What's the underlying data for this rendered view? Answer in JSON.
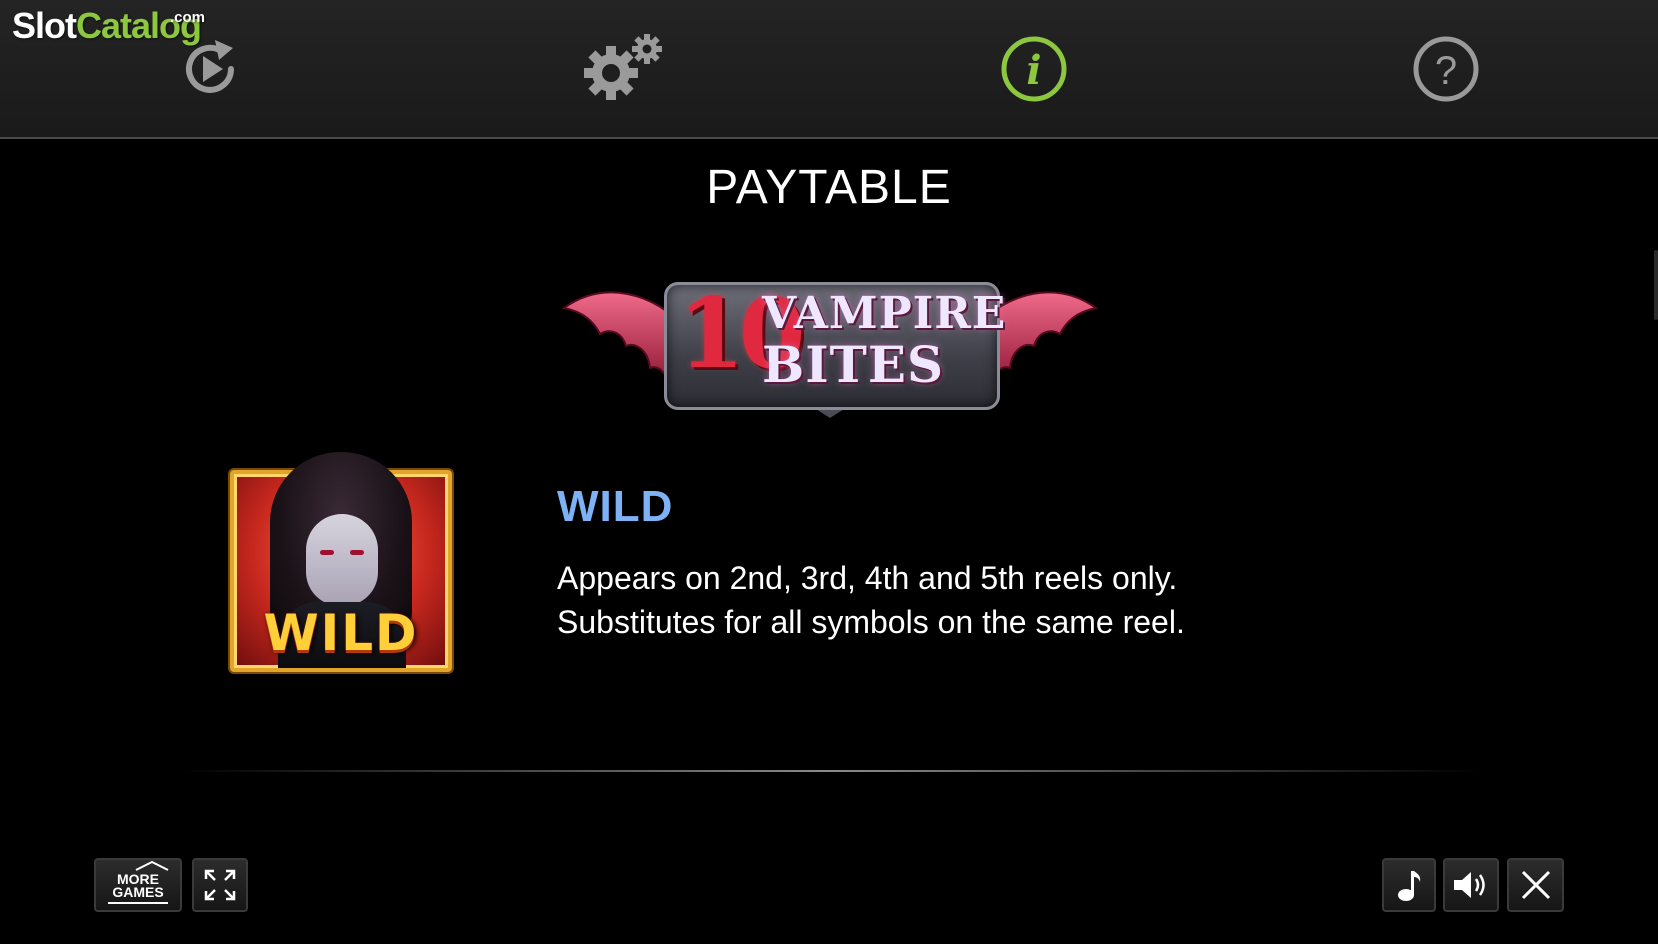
{
  "watermark": {
    "part1": "Slot",
    "part2": "Catalog",
    "suffix": ".com"
  },
  "top_nav": {
    "items": [
      {
        "id": "autoplay",
        "icon": "autoplay-replay-icon",
        "active": false
      },
      {
        "id": "settings",
        "icon": "gears-icon",
        "active": false
      },
      {
        "id": "info",
        "icon": "info-icon",
        "active": true
      },
      {
        "id": "help",
        "icon": "question-icon",
        "active": false
      }
    ],
    "active_color": "#8dc63f",
    "inactive_color": "#9a9a9a"
  },
  "page": {
    "title": "PAYTABLE"
  },
  "logo": {
    "number": "10",
    "line1": "VAMPIRE",
    "line2": "BITES"
  },
  "symbol": {
    "label": "WILD",
    "heading": "WILD",
    "description_line1": "Appears on 2nd, 3rd, 4th and 5th reels only.",
    "description_line2": "Substitutes for all symbols on the same reel."
  },
  "bottom_bar": {
    "more_games_line1": "MORE",
    "more_games_line2": "GAMES",
    "fullscreen_icon": "fullscreen-icon",
    "music_icon": "music-note-icon",
    "sound_icon": "speaker-icon",
    "close_icon": "close-icon"
  },
  "colors": {
    "heading_blue": "#7db2f5",
    "background": "#000000",
    "topbar": "#1f1f1f"
  }
}
